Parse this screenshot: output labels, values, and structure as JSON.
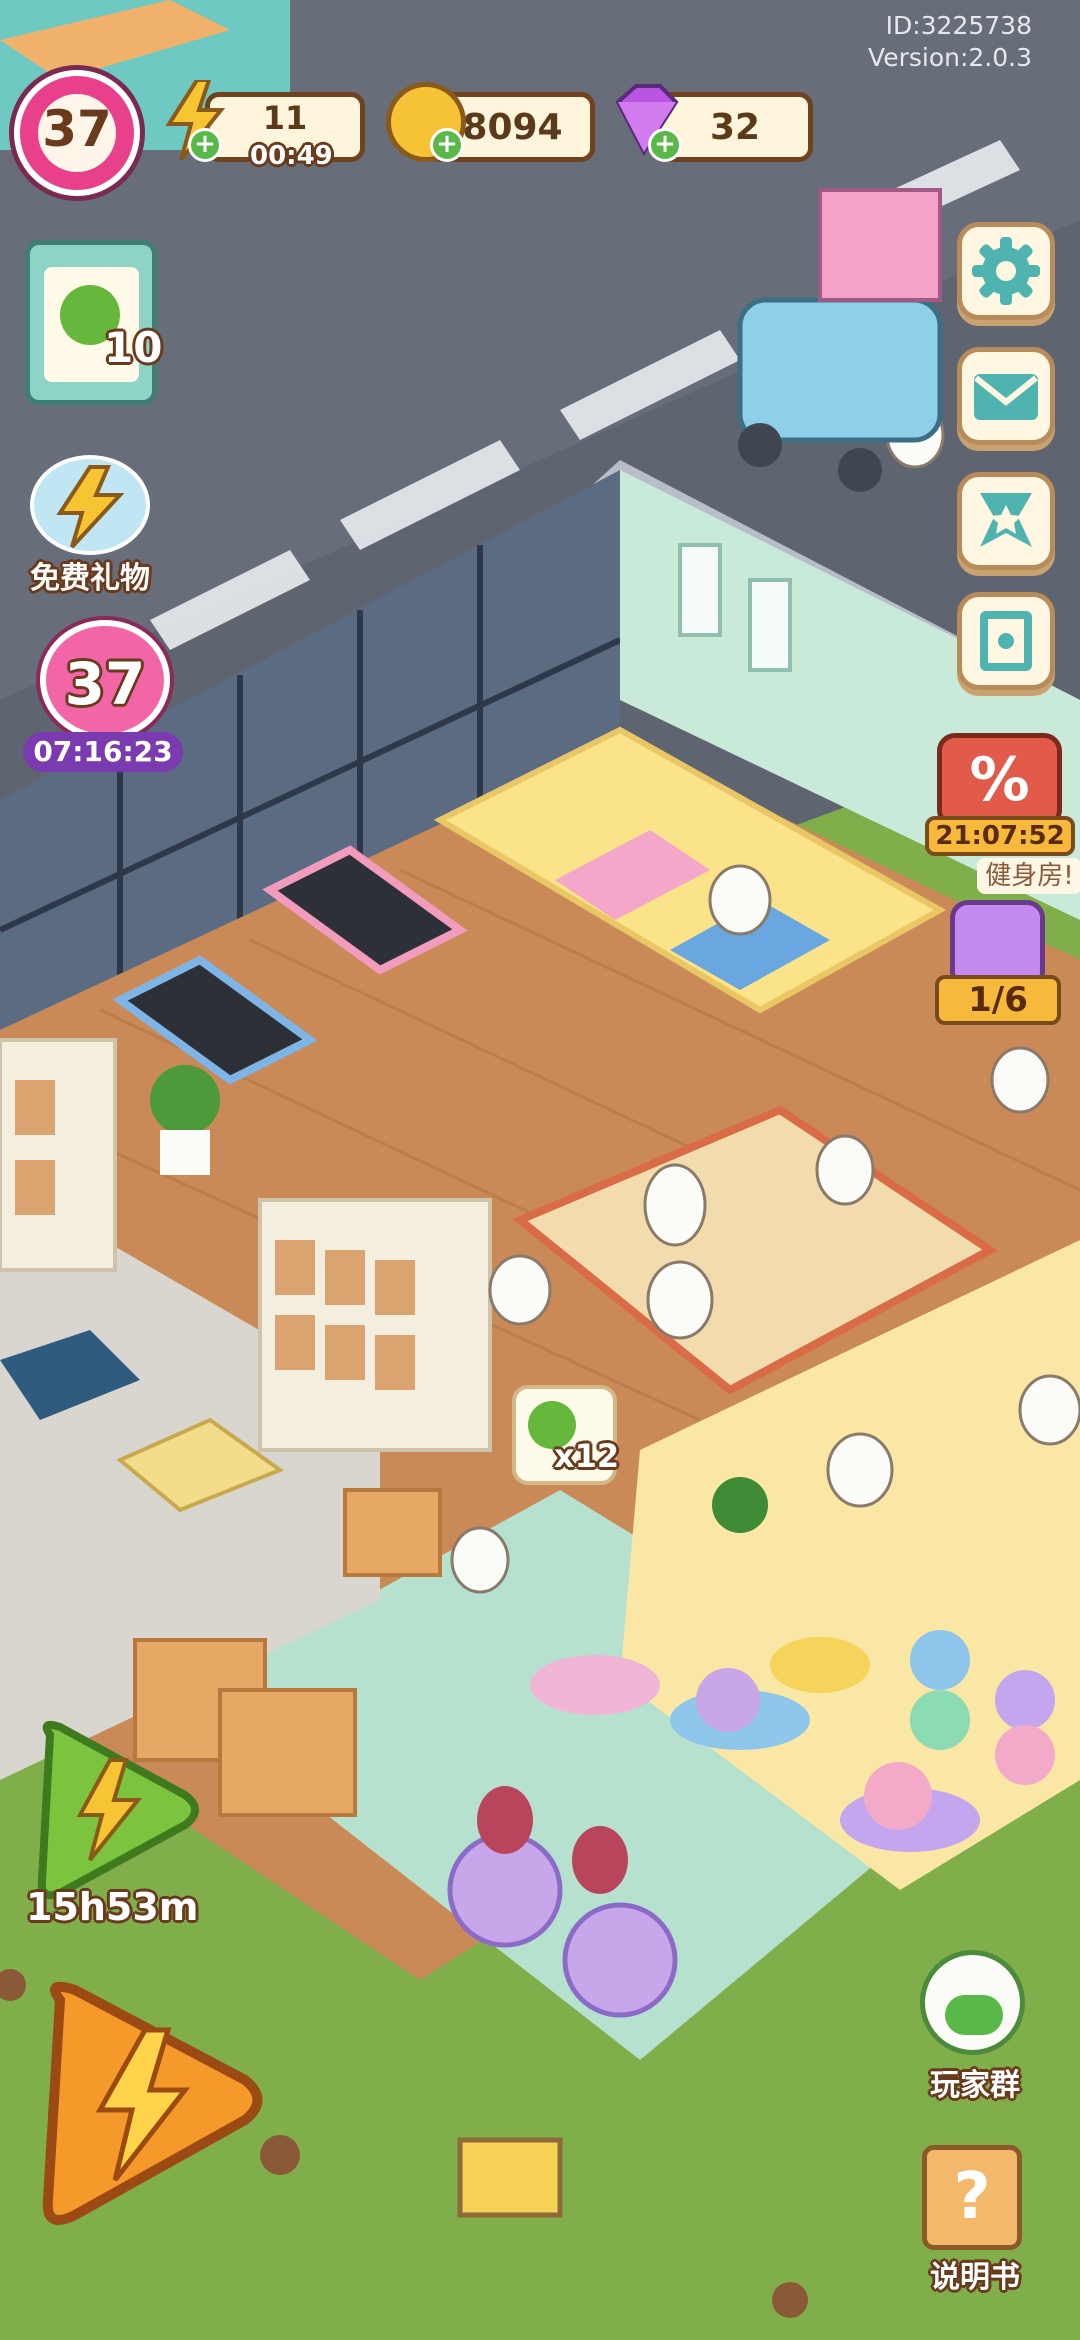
{
  "account": {
    "id_text": "ID:3225738",
    "version_text": "Version:2.0.3"
  },
  "player": {
    "level": "37"
  },
  "energy": {
    "amount": "11",
    "timer": "00:49"
  },
  "coins": {
    "amount": "8094"
  },
  "gems": {
    "amount": "32"
  },
  "clipboard": {
    "count": "10"
  },
  "free_gift": {
    "label": "免费礼物"
  },
  "event_level": {
    "level": "37",
    "timer": "07:16:23"
  },
  "sale": {
    "timer": "21:07:52",
    "subtitle": "健身房!"
  },
  "collection": {
    "progress": "1/6"
  },
  "speech_bubble": {
    "count": "x12"
  },
  "boost": {
    "timer": "15h53m"
  },
  "player_group": {
    "label": "玩家群"
  },
  "manual": {
    "label": "说明书"
  },
  "icons": [
    "level-badge-icon",
    "energy-icon",
    "coin-icon",
    "gem-icon",
    "clover-icon",
    "gift-icon",
    "settings-gear-icon",
    "mail-icon",
    "trophy-icon",
    "book-icon",
    "percent-sale-icon",
    "jar-icon",
    "lightning-icon",
    "chat-icon",
    "question-icon"
  ],
  "colors": {
    "accent_pink": "#e8408a",
    "panel_border": "#6e4420",
    "plus_green": "#58b848",
    "grass": "#7fae4a",
    "floor_wood": "#c98a58",
    "floor_mint": "#b6e1cf"
  }
}
